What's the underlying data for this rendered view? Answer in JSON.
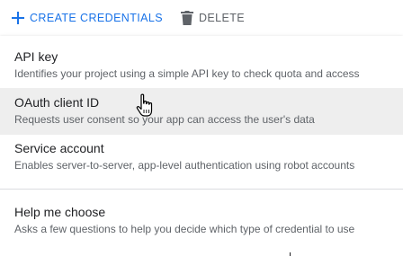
{
  "toolbar": {
    "create_label": "CREATE CREDENTIALS",
    "create_icon": "plus-icon",
    "delete_label": "DELETE",
    "delete_icon": "trash-icon",
    "accent_color": "#1a73e8",
    "muted_color": "#5f6368"
  },
  "menu": {
    "items": [
      {
        "title": "API key",
        "description": "Identifies your project using a simple API key to check quota and access"
      },
      {
        "title": "OAuth client ID",
        "description": "Requests user consent so your app can access the user's data",
        "hovered": true
      },
      {
        "title": "Service account",
        "description": "Enables server-to-server, app-level authentication using robot accounts"
      },
      {
        "title": "Help me choose",
        "description": "Asks a few questions to help you decide which type of credential to use"
      }
    ],
    "hover_background": "#eeeeee"
  },
  "cursor": {
    "icon": "hand-pointer-icon"
  }
}
